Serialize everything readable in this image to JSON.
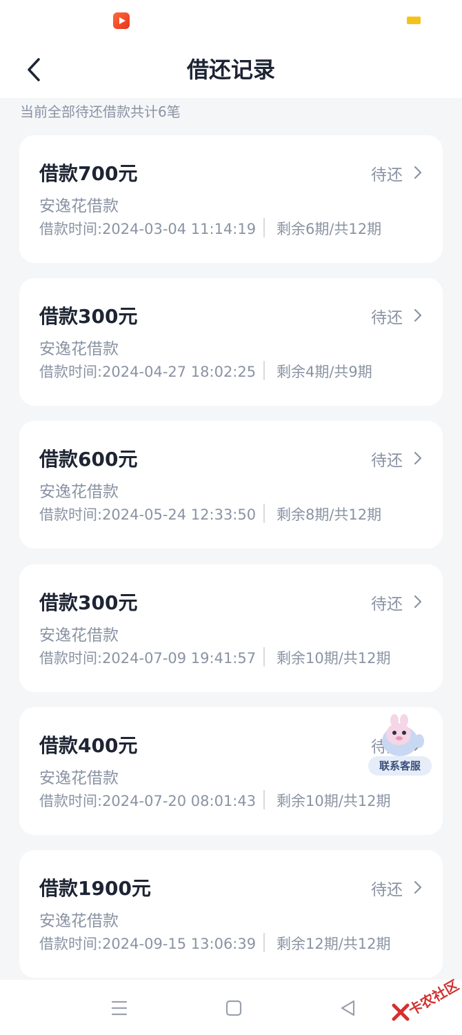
{
  "status_bar": {
    "app_icon": "video-app-icon",
    "battery_icon": "battery-icon"
  },
  "header": {
    "title": "借还记录",
    "back_icon": "chevron-left-icon"
  },
  "summary": "当前全部待还借款共计6笔",
  "loans": [
    {
      "amount": "借款700元",
      "status": "待还",
      "product": "安逸花借款",
      "time": "借款时间:2024-03-04 11:14:19",
      "periods": "剩余6期/共12期"
    },
    {
      "amount": "借款300元",
      "status": "待还",
      "product": "安逸花借款",
      "time": "借款时间:2024-04-27 18:02:25",
      "periods": "剩余4期/共9期"
    },
    {
      "amount": "借款600元",
      "status": "待还",
      "product": "安逸花借款",
      "time": "借款时间:2024-05-24 12:33:50",
      "periods": "剩余8期/共12期"
    },
    {
      "amount": "借款300元",
      "status": "待还",
      "product": "安逸花借款",
      "time": "借款时间:2024-07-09 19:41:57",
      "periods": "剩余10期/共12期"
    },
    {
      "amount": "借款400元",
      "status": "待还",
      "product": "安逸花借款",
      "time": "借款时间:2024-07-20 08:01:43",
      "periods": "剩余10期/共12期"
    },
    {
      "amount": "借款1900元",
      "status": "待还",
      "product": "安逸花借款",
      "time": "借款时间:2024-09-15 13:06:39",
      "periods": "剩余12期/共12期"
    }
  ],
  "service_float": {
    "label": "联系客服",
    "icon": "mascot-icon"
  },
  "bottom_nav": {
    "menu_icon": "menu-icon",
    "home_icon": "home-square-icon",
    "back_icon": "back-triangle-icon"
  },
  "watermark": {
    "text": "卡农社区"
  },
  "colors": {
    "text_primary": "#1d2433",
    "text_secondary": "#8a93a3",
    "background": "#f5f6f8",
    "card": "#ffffff"
  }
}
